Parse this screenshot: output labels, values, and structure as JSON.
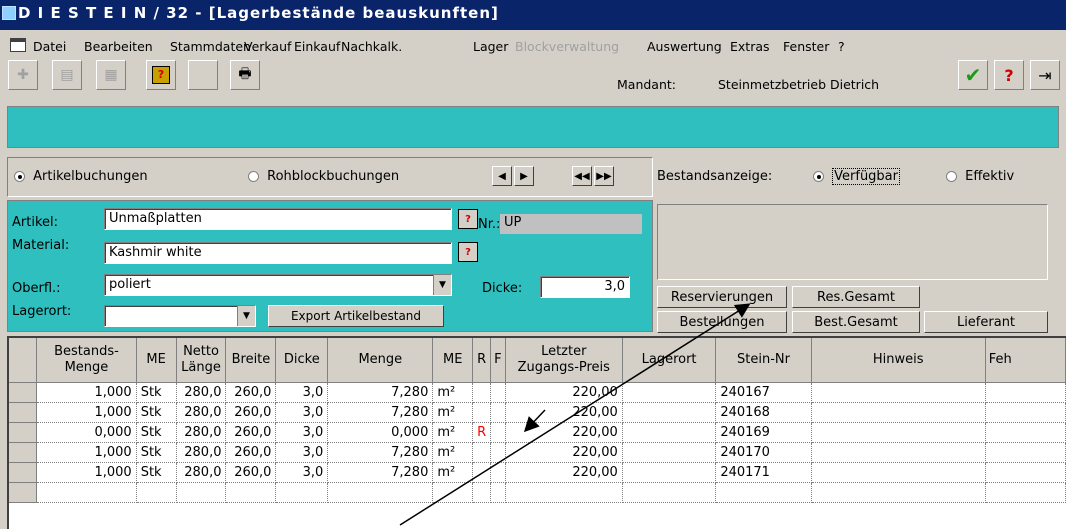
{
  "window": {
    "title": "D I E S T E I N / 32 - [Lagerbestände beauskunften]"
  },
  "menu": [
    {
      "label": "Datei",
      "enabled": true
    },
    {
      "label": "Bearbeiten",
      "enabled": true
    },
    {
      "label": "Stammdaten",
      "enabled": true
    },
    {
      "label": "Verkauf",
      "enabled": true
    },
    {
      "label": "Einkauf",
      "enabled": true
    },
    {
      "label": "Nachkalk.",
      "enabled": true
    },
    {
      "label": "Lager",
      "enabled": true
    },
    {
      "label": "Blockverwaltung",
      "enabled": false
    },
    {
      "label": "Auswertung",
      "enabled": true
    },
    {
      "label": "Extras",
      "enabled": true
    },
    {
      "label": "Fenster",
      "enabled": true
    },
    {
      "label": "?",
      "enabled": true
    }
  ],
  "toolbar": {
    "mandant_label": "Mandant:",
    "mandant_value": "Steinmetzbetrieb Dietrich"
  },
  "mode": {
    "artikel_label": "Artikelbuchungen",
    "rohblock_label": "Rohblockbuchungen",
    "selected": "artikel"
  },
  "bestand": {
    "label": "Bestandsanzeige:",
    "verfuegbar_label": "Verfügbar",
    "effektiv_label": "Effektiv",
    "selected": "verfuegbar"
  },
  "form": {
    "artikel_label": "Artikel:",
    "artikel_value": "Unmaßplatten",
    "material_label": "Material:",
    "material_value": "Kashmir white",
    "oberfl_label": "Oberfl.:",
    "oberfl_value": "poliert",
    "lagerort_label": "Lagerort:",
    "lagerort_value": "",
    "nr_label": "Nr.:",
    "nr_value": "UP",
    "dicke_label": "Dicke:",
    "dicke_value": "3,0",
    "export_label": "Export Artikelbestand"
  },
  "buttons": {
    "reservierungen": "Reservierungen",
    "res_gesamt": "Res.Gesamt",
    "bestellungen": "Bestellungen",
    "best_gesamt": "Best.Gesamt",
    "lieferant": "Lieferant"
  },
  "table": {
    "headers": [
      "Bestands-\nMenge",
      "ME",
      "Netto\nLänge",
      "Breite",
      "Dicke",
      "Menge",
      "ME",
      "R",
      "F",
      "Letzter\nZugangs-Preis",
      "Lagerort",
      "Stein-Nr",
      "Hinweis",
      "Feh"
    ],
    "rows": [
      [
        "1,000",
        "Stk",
        "280,0",
        "260,0",
        "3,0",
        "7,280",
        "m²",
        "",
        "",
        "220,00",
        "",
        "240167",
        "",
        ""
      ],
      [
        "1,000",
        "Stk",
        "280,0",
        "260,0",
        "3,0",
        "7,280",
        "m²",
        "",
        "",
        "220,00",
        "",
        "240168",
        "",
        ""
      ],
      [
        "0,000",
        "Stk",
        "280,0",
        "260,0",
        "3,0",
        "0,000",
        "m²",
        "R",
        "",
        "220,00",
        "",
        "240169",
        "",
        ""
      ],
      [
        "1,000",
        "Stk",
        "280,0",
        "260,0",
        "3,0",
        "7,280",
        "m²",
        "",
        "",
        "220,00",
        "",
        "240170",
        "",
        ""
      ],
      [
        "1,000",
        "Stk",
        "280,0",
        "260,0",
        "3,0",
        "7,280",
        "m²",
        "",
        "",
        "220,00",
        "",
        "240171",
        "",
        ""
      ]
    ]
  },
  "colors": {
    "title_bar": "#0a246a",
    "panel": "#2fbfbf",
    "reserved_flag": "#ff0000"
  }
}
